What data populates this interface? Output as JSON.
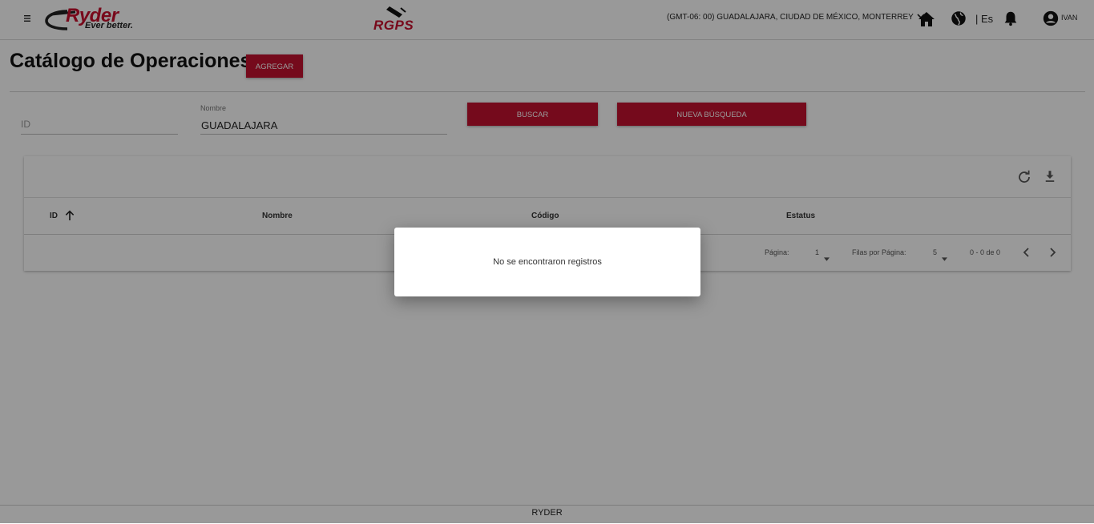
{
  "header": {
    "logo_text": "Ryder",
    "logo_tagline": "Ever better.",
    "product_logo_text": "RGPS",
    "timezone": "(GMT-06: 00) GUADALAJARA, CIUDAD DE MÉXICO, MONTERREY",
    "language": "| Es",
    "user_name": "IVAN",
    "icons": [
      "menu-icon",
      "home-icon",
      "globe-icon",
      "bell-icon",
      "account-circle-icon"
    ]
  },
  "page": {
    "title": "Catálogo de Operaciones",
    "add_button": "AGREGAR"
  },
  "filters": {
    "id_placeholder": "ID",
    "id_value": "",
    "name_label": "Nombre",
    "name_value": "GUADALAJARA",
    "search_button": "BUSCAR",
    "new_search_button": "NUEVA BÚSQUEDA"
  },
  "table": {
    "columns": [
      "ID",
      "Nombre",
      "Código",
      "Estatus"
    ],
    "sort_column": "ID",
    "sort_direction": "ascending",
    "rows": [],
    "pagination": {
      "page_label": "Página:",
      "page_value": "1",
      "rows_label": "Filas por Página:",
      "rows_value": "5",
      "range": "0 - 0 de 0"
    }
  },
  "dialog": {
    "message": "No se encontraron registros"
  },
  "footer": {
    "text": "RYDER"
  },
  "colors": {
    "brand_red": "#c4122f",
    "overlay": "rgba(0,0,0,0.40)"
  }
}
